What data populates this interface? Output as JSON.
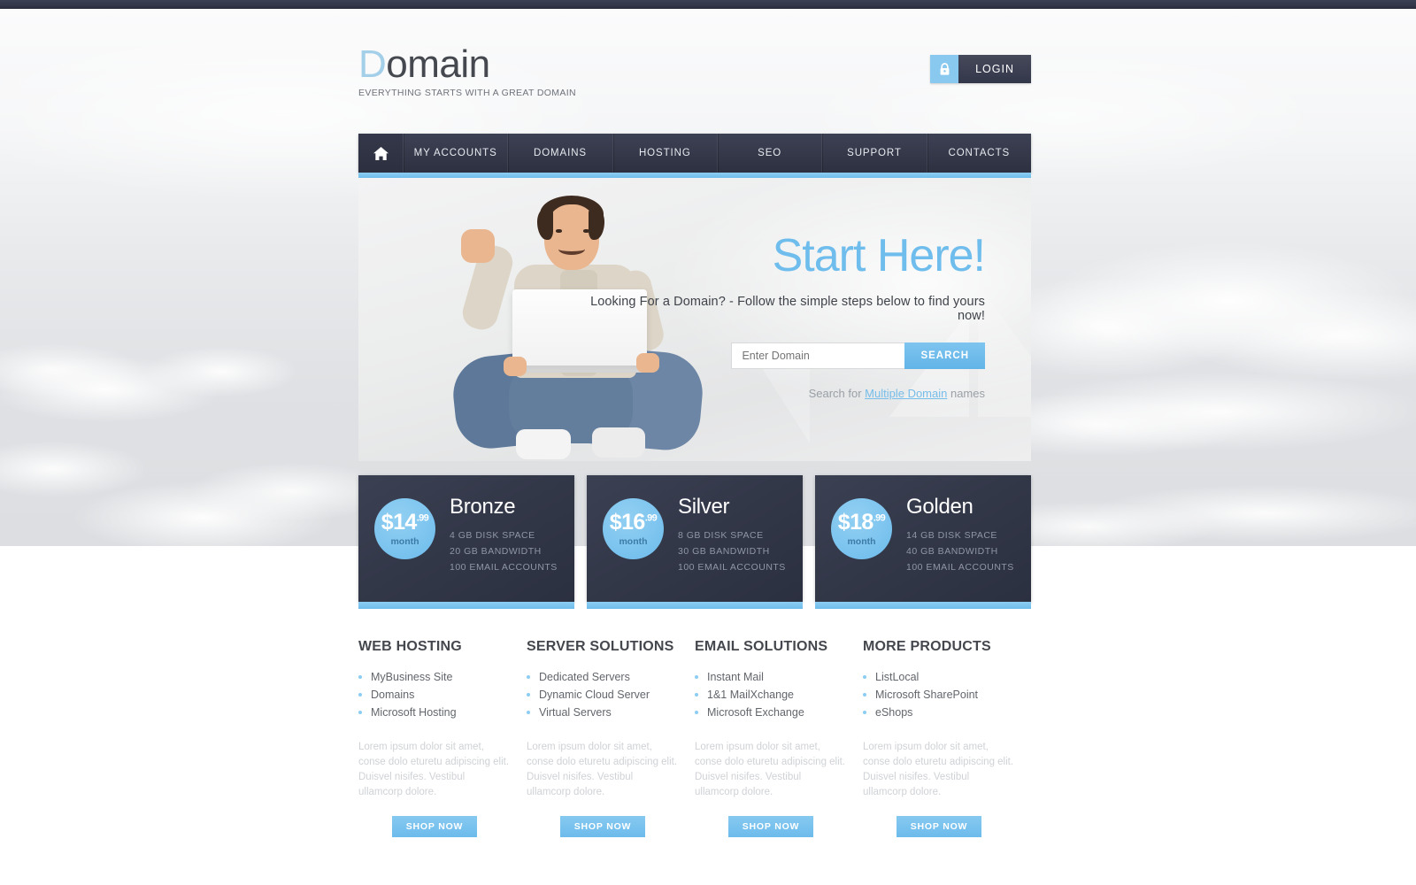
{
  "topbar": {
    "present": true
  },
  "header": {
    "logo_first": "D",
    "logo_rest": "omain",
    "tagline": "EVERYTHING STARTS WITH A GREAT DOMAIN",
    "login_label": "LOGIN",
    "lock_icon": "lock-icon"
  },
  "nav": {
    "home_icon": "home-icon",
    "items": [
      {
        "label": "MY ACCOUNTS"
      },
      {
        "label": "DOMAINS"
      },
      {
        "label": "HOSTING"
      },
      {
        "label": "SEO"
      },
      {
        "label": "SUPPORT"
      },
      {
        "label": "CONTACTS"
      }
    ]
  },
  "hero": {
    "title": "Start Here!",
    "subtitle": "Looking For a Domain? - Follow the simple steps below to find yours now!",
    "search_placeholder": "Enter Domain",
    "search_value": "",
    "search_button": "SEARCH",
    "multi_prefix": "Search for ",
    "multi_link": "Multiple Domain",
    "multi_suffix": " names"
  },
  "plans": [
    {
      "name": "Bronze",
      "price": "$14",
      "cents": ".99",
      "period": "month",
      "features": [
        "4 GB DISK SPACE",
        "20 GB BANDWIDTH",
        "100 EMAIL ACCOUNTS"
      ]
    },
    {
      "name": "Silver",
      "price": "$16",
      "cents": ".99",
      "period": "month",
      "features": [
        "8 GB DISK SPACE",
        "30 GB BANDWIDTH",
        "100 EMAIL ACCOUNTS"
      ]
    },
    {
      "name": "Golden",
      "price": "$18",
      "cents": ".99",
      "period": "month",
      "features": [
        "14 GB DISK SPACE",
        "40 GB BANDWIDTH",
        "100 EMAIL ACCOUNTS"
      ]
    }
  ],
  "columns": [
    {
      "title": "WEB HOSTING",
      "items": [
        "MyBusiness Site",
        "Domains",
        "Microsoft Hosting"
      ],
      "paragraph": "Lorem ipsum dolor sit amet, conse dolo eturetu adipiscing elit. Duisvel nisifes. Vestibul ullamcorp dolore.",
      "button": "SHOP NOW"
    },
    {
      "title": "SERVER SOLUTIONS",
      "items": [
        "Dedicated Servers",
        "Dynamic Cloud Server",
        "Virtual Servers"
      ],
      "paragraph": "Lorem ipsum dolor sit amet, conse dolo eturetu adipiscing elit. Duisvel nisifes. Vestibul ullamcorp dolore.",
      "button": "SHOP NOW"
    },
    {
      "title": "EMAIL SOLUTIONS",
      "items": [
        "Instant Mail",
        "1&1 MailXchange",
        "Microsoft Exchange"
      ],
      "paragraph": "Lorem ipsum dolor sit amet, conse dolo eturetu adipiscing elit. Duisvel nisifes. Vestibul ullamcorp dolore.",
      "button": "SHOP NOW"
    },
    {
      "title": "MORE PRODUCTS",
      "items": [
        "ListLocal",
        "Microsoft SharePoint",
        "eShops"
      ],
      "paragraph": "Lorem ipsum dolor sit amet, conse dolo eturetu adipiscing elit. Duisvel nisifes. Vestibul ullamcorp dolore.",
      "button": "SHOP NOW"
    }
  ],
  "colors": {
    "accent_blue": "#6fbdec",
    "light_blue": "#8ccdf2",
    "dark_navy": "#333849",
    "text_dark": "#44474d",
    "text_gray": "#62666c"
  }
}
